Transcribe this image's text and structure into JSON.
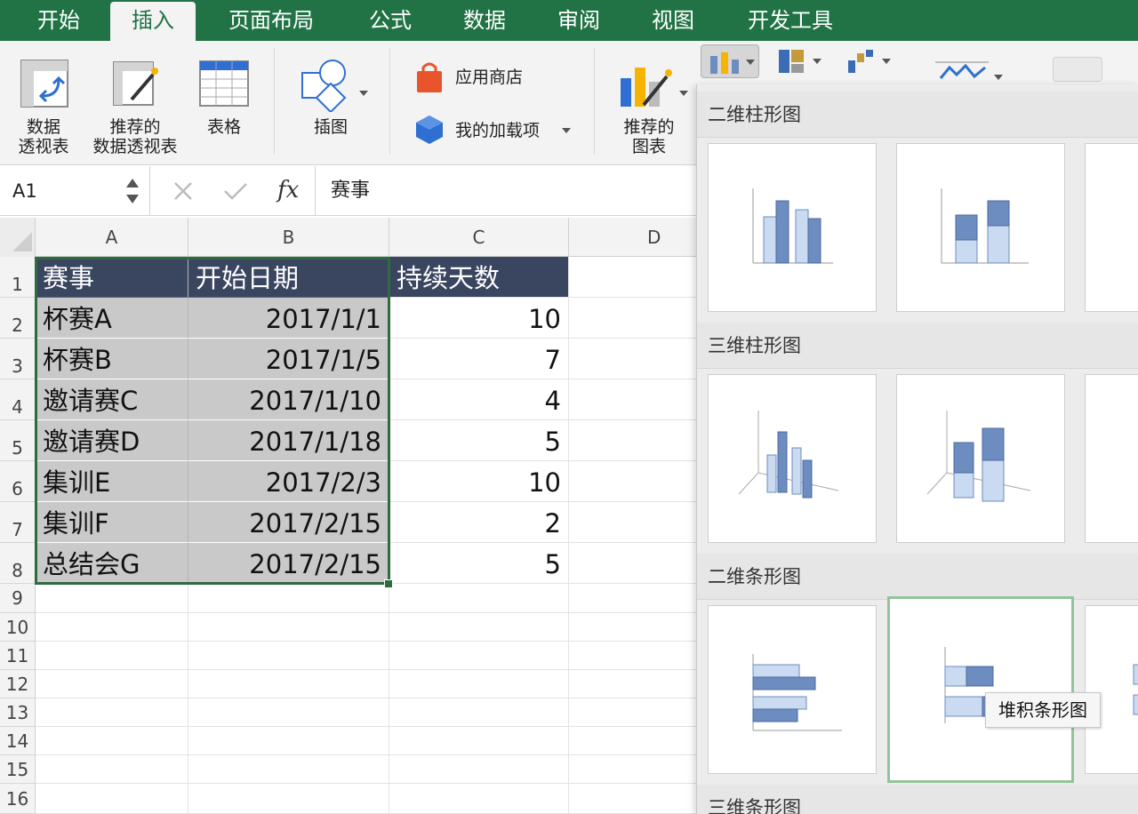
{
  "tabs": [
    "开始",
    "插入",
    "页面布局",
    "公式",
    "数据",
    "审阅",
    "视图",
    "开发工具"
  ],
  "active_tab": "插入",
  "ribbon": {
    "pivot_table": [
      "数据",
      "透视表"
    ],
    "recommended_pivot": [
      "推荐的",
      "数据透视表"
    ],
    "table": "表格",
    "illustrations": "插图",
    "app_store": "应用商店",
    "my_addins": "我的加载项",
    "recommended_charts": [
      "推荐的",
      "图表"
    ]
  },
  "formula_bar": {
    "name_box": "A1",
    "fx": "fx",
    "value": "赛事"
  },
  "columns": [
    "A",
    "B",
    "C",
    "D"
  ],
  "rows": [
    "1",
    "2",
    "3",
    "4",
    "5",
    "6",
    "7",
    "8",
    "9",
    "10",
    "11",
    "12",
    "13",
    "14",
    "15",
    "16"
  ],
  "table": {
    "headers": [
      "赛事",
      "开始日期",
      "持续天数"
    ],
    "rows": [
      [
        "杯赛A",
        "2017/1/1",
        "10"
      ],
      [
        "杯赛B",
        "2017/1/5",
        "7"
      ],
      [
        "邀请赛C",
        "2017/1/10",
        "4"
      ],
      [
        "邀请赛D",
        "2017/1/18",
        "5"
      ],
      [
        "集训E",
        "2017/2/3",
        "10"
      ],
      [
        "集训F",
        "2017/2/15",
        "2"
      ],
      [
        "总结会G",
        "2017/2/15",
        "5"
      ]
    ]
  },
  "chart_panel": {
    "sections": [
      "二维柱形图",
      "三维柱形图",
      "二维条形图",
      "三维条形图"
    ],
    "tooltip": "堆积条形图"
  },
  "colors": {
    "excel_green": "#217346",
    "header_fill": "#3a4560",
    "selection_fill": "#c9c9c9",
    "bar_dark": "#6d8cc0",
    "bar_light": "#c9daf1"
  }
}
